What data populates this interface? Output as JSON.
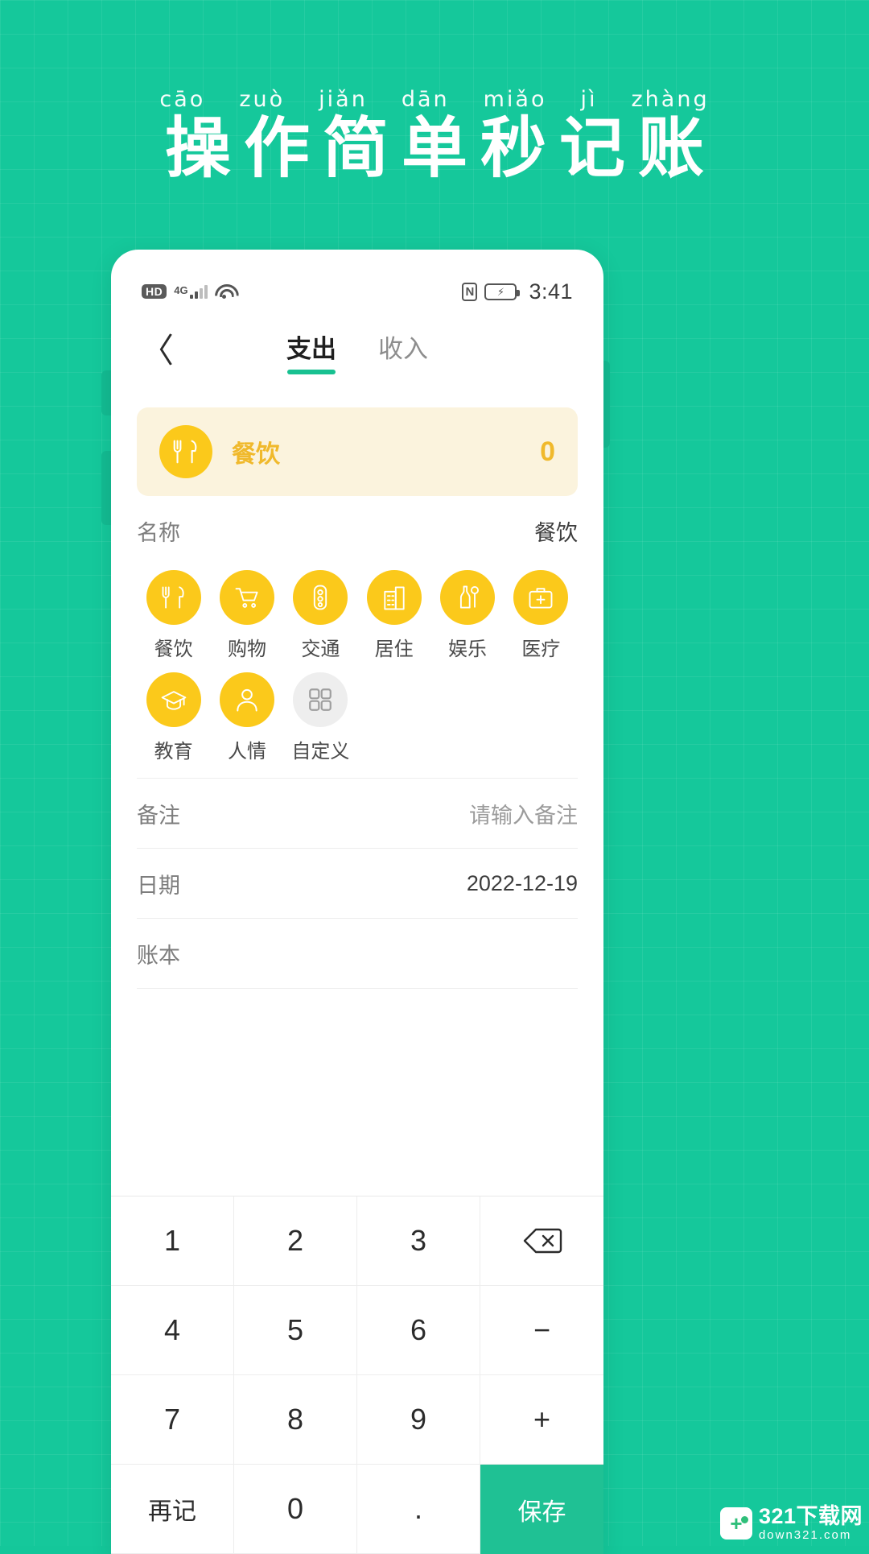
{
  "promo": {
    "pinyin": [
      "cāo",
      "zuò",
      "jiǎn",
      "dān",
      "miǎo",
      "jì",
      "zhàng"
    ],
    "headline": "操作简单秒记账"
  },
  "theme": {
    "background_green": "#15c89b",
    "accent_green": "#1fc194",
    "accent_yellow": "#fbc91b",
    "card_yellow_bg": "#fbf3dd",
    "card_yellow_text": "#f0b92c"
  },
  "statusbar": {
    "hd_label": "HD",
    "network_label": "4G",
    "wifi_icon": "wifi-icon",
    "nfc_icon": "nfc-icon",
    "battery_icon": "battery-charging-icon",
    "time": "3:41"
  },
  "navbar": {
    "back_icon": "〈",
    "tabs": [
      {
        "label": "支出",
        "active": true
      },
      {
        "label": "收入",
        "active": false
      }
    ]
  },
  "amount_card": {
    "icon": "dining-icon",
    "category": "餐饮",
    "value": "0"
  },
  "name_row": {
    "label": "名称",
    "value": "餐饮"
  },
  "categories": [
    {
      "label": "餐饮",
      "icon": "dining-icon",
      "selected": true,
      "style": "yellow"
    },
    {
      "label": "购物",
      "icon": "shopping-cart-icon",
      "selected": false,
      "style": "yellow"
    },
    {
      "label": "交通",
      "icon": "traffic-light-icon",
      "selected": false,
      "style": "yellow"
    },
    {
      "label": "居住",
      "icon": "building-icon",
      "selected": false,
      "style": "yellow"
    },
    {
      "label": "娱乐",
      "icon": "entertainment-icon",
      "selected": false,
      "style": "yellow"
    },
    {
      "label": "医疗",
      "icon": "medical-kit-icon",
      "selected": false,
      "style": "yellow"
    },
    {
      "label": "教育",
      "icon": "graduation-cap-icon",
      "selected": false,
      "style": "yellow"
    },
    {
      "label": "人情",
      "icon": "person-icon",
      "selected": false,
      "style": "yellow"
    },
    {
      "label": "自定义",
      "icon": "grid-squares-icon",
      "selected": false,
      "style": "neutral"
    }
  ],
  "form_rows": [
    {
      "label": "备注",
      "value": "请输入备注",
      "placeholder": true
    },
    {
      "label": "日期",
      "value": "2022-12-19",
      "placeholder": false
    },
    {
      "label": "账本",
      "value": "",
      "placeholder": false
    }
  ],
  "keypad": [
    {
      "label": "1",
      "type": "digit"
    },
    {
      "label": "2",
      "type": "digit"
    },
    {
      "label": "3",
      "type": "digit"
    },
    {
      "label": "",
      "type": "backspace",
      "icon": "backspace-icon"
    },
    {
      "label": "4",
      "type": "digit"
    },
    {
      "label": "5",
      "type": "digit"
    },
    {
      "label": "6",
      "type": "digit"
    },
    {
      "label": "−",
      "type": "operator"
    },
    {
      "label": "7",
      "type": "digit"
    },
    {
      "label": "8",
      "type": "digit"
    },
    {
      "label": "9",
      "type": "digit"
    },
    {
      "label": "+",
      "type": "operator"
    },
    {
      "label": "再记",
      "type": "action"
    },
    {
      "label": "0",
      "type": "digit"
    },
    {
      "label": ".",
      "type": "digit"
    },
    {
      "label": "保存",
      "type": "save"
    }
  ],
  "watermark": {
    "title": "321下载网",
    "subtitle": "down321.com",
    "logo_icon": "plus-logo-icon"
  }
}
